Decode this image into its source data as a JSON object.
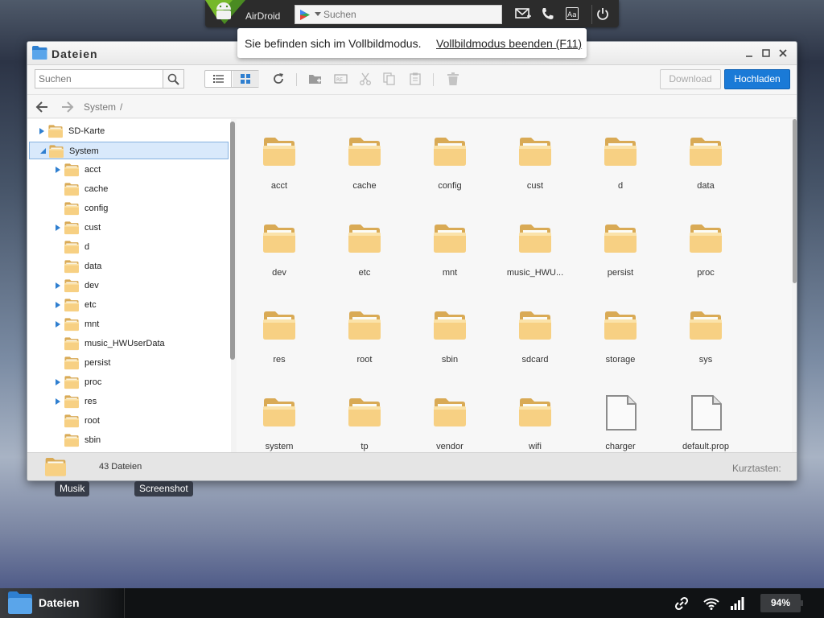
{
  "topbar": {
    "brand": "AirDroid",
    "search_placeholder": "Suchen",
    "icons": [
      "airdroid-logo",
      "google-play-icon",
      "mail-add-icon",
      "phone-icon",
      "font-size-icon",
      "power-icon"
    ]
  },
  "fullscreen_notice": {
    "message": "Sie befinden sich im Vollbildmodus.",
    "exit_link": "Vollbildmodus beenden (F11)"
  },
  "window": {
    "title": "Dateien",
    "controls": [
      "minimize",
      "maximize",
      "close"
    ]
  },
  "toolbar": {
    "search_placeholder": "Suchen",
    "download_label": "Download",
    "upload_label": "Hochladen",
    "tools": [
      "list-view",
      "grid-view",
      "refresh",
      "new-folder",
      "rename",
      "cut",
      "copy",
      "paste",
      "delete"
    ]
  },
  "breadcrumb": {
    "path": "System",
    "separator": "/"
  },
  "tree": [
    {
      "label": "SD-Karte",
      "level": 0,
      "expandable": true,
      "expanded": false
    },
    {
      "label": "System",
      "level": 0,
      "expandable": true,
      "expanded": true,
      "selected": true
    },
    {
      "label": "acct",
      "level": 1,
      "expandable": true
    },
    {
      "label": "cache",
      "level": 1,
      "expandable": false
    },
    {
      "label": "config",
      "level": 1,
      "expandable": false
    },
    {
      "label": "cust",
      "level": 1,
      "expandable": true
    },
    {
      "label": "d",
      "level": 1,
      "expandable": false
    },
    {
      "label": "data",
      "level": 1,
      "expandable": false
    },
    {
      "label": "dev",
      "level": 1,
      "expandable": true
    },
    {
      "label": "etc",
      "level": 1,
      "expandable": true
    },
    {
      "label": "mnt",
      "level": 1,
      "expandable": true
    },
    {
      "label": "music_HWUserData",
      "level": 1,
      "expandable": false
    },
    {
      "label": "persist",
      "level": 1,
      "expandable": false
    },
    {
      "label": "proc",
      "level": 1,
      "expandable": true
    },
    {
      "label": "res",
      "level": 1,
      "expandable": true
    },
    {
      "label": "root",
      "level": 1,
      "expandable": false
    },
    {
      "label": "sbin",
      "level": 1,
      "expandable": false
    }
  ],
  "files": [
    {
      "name": "acct",
      "type": "folder"
    },
    {
      "name": "cache",
      "type": "folder"
    },
    {
      "name": "config",
      "type": "folder"
    },
    {
      "name": "cust",
      "type": "folder"
    },
    {
      "name": "d",
      "type": "folder"
    },
    {
      "name": "data",
      "type": "folder"
    },
    {
      "name": "dev",
      "type": "folder"
    },
    {
      "name": "etc",
      "type": "folder"
    },
    {
      "name": "mnt",
      "type": "folder"
    },
    {
      "name": "music_HWU...",
      "type": "folder"
    },
    {
      "name": "persist",
      "type": "folder"
    },
    {
      "name": "proc",
      "type": "folder"
    },
    {
      "name": "res",
      "type": "folder"
    },
    {
      "name": "root",
      "type": "folder"
    },
    {
      "name": "sbin",
      "type": "folder"
    },
    {
      "name": "sdcard",
      "type": "folder"
    },
    {
      "name": "storage",
      "type": "folder"
    },
    {
      "name": "sys",
      "type": "folder"
    },
    {
      "name": "system",
      "type": "folder"
    },
    {
      "name": "tp",
      "type": "folder"
    },
    {
      "name": "vendor",
      "type": "folder"
    },
    {
      "name": "wifi",
      "type": "folder"
    },
    {
      "name": "charger",
      "type": "file"
    },
    {
      "name": "default.prop",
      "type": "file"
    }
  ],
  "status": {
    "count": "43 Dateien",
    "shortcuts": "Kurztasten:"
  },
  "desktop_labels": {
    "music": "Musik",
    "screenshot": "Screenshot"
  },
  "taskbar": {
    "app_label": "Dateien",
    "battery": "94%",
    "icons": [
      "link-icon",
      "wifi-icon",
      "signal-icon"
    ]
  },
  "colors": {
    "accent": "#1a7ad7",
    "folder": "#f6cf7c",
    "selection": "#d9e9fb"
  }
}
